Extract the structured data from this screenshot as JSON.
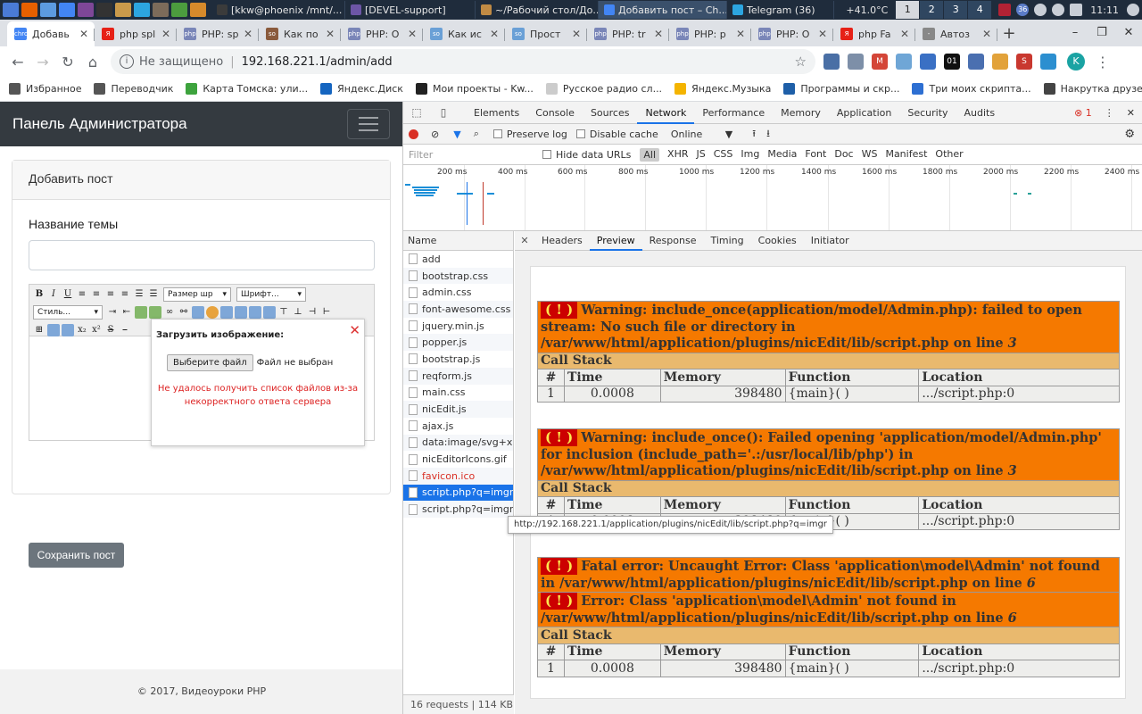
{
  "taskbar": {
    "tasks": [
      {
        "label": "[kkw@phoenix /mnt/...",
        "color": "#3b3b3b"
      },
      {
        "label": "[DEVEL-support]",
        "color": "#6d56a6"
      },
      {
        "label": "~/Рабочий стол/До...",
        "color": "#c08a44"
      },
      {
        "label": "Добавить пост – Ch...",
        "color": "#4285f4",
        "active": true
      },
      {
        "label": "Telegram (36)",
        "color": "#2ca5e0"
      }
    ],
    "temperature": "+41.0°C",
    "workspaces": [
      "1",
      "2",
      "3",
      "4"
    ],
    "clock": "11:11",
    "tray_badge": "36"
  },
  "browser": {
    "tabs": [
      {
        "title": "Добавь",
        "fav": "chrome",
        "color": "#4285f4",
        "active": true
      },
      {
        "title": "php spl",
        "fav": "Я",
        "color": "#e62117"
      },
      {
        "title": "PHP: sp",
        "fav": "php",
        "color": "#7a86b8"
      },
      {
        "title": "Как по",
        "fav": "so",
        "color": "#8a5a3c"
      },
      {
        "title": "PHP: O",
        "fav": "php",
        "color": "#7a86b8"
      },
      {
        "title": "Как ис",
        "fav": "so",
        "color": "#6aa0d6"
      },
      {
        "title": "Прост",
        "fav": "so",
        "color": "#6aa0d6"
      },
      {
        "title": "PHP: tr",
        "fav": "php",
        "color": "#7a86b8"
      },
      {
        "title": "PHP: p",
        "fav": "php",
        "color": "#7a86b8"
      },
      {
        "title": "PHP: O",
        "fav": "php",
        "color": "#7a86b8"
      },
      {
        "title": "php Fa",
        "fav": "Я",
        "color": "#e62117"
      },
      {
        "title": "Автоз",
        "fav": "-",
        "color": "#888888"
      }
    ],
    "omnibox": {
      "security": "Не защищено",
      "url": "192.168.221.1/admin/add"
    },
    "profile_initial": "K",
    "extensions": [
      {
        "color": "#4a6fa5",
        "label": ""
      },
      {
        "color": "#7d8fa8",
        "label": ""
      },
      {
        "color": "#d44638",
        "label": "M"
      },
      {
        "color": "#6fa6d6",
        "label": ""
      },
      {
        "color": "#3a70c4",
        "label": ""
      },
      {
        "color": "#111111",
        "label": "01"
      },
      {
        "color": "#4a6fb0",
        "label": ""
      },
      {
        "color": "#e2a23a",
        "label": ""
      },
      {
        "color": "#c9382f",
        "label": "S"
      },
      {
        "color": "#2c8fd0",
        "label": ""
      }
    ],
    "bookmarks": [
      {
        "label": "Избранное",
        "color": "#555555"
      },
      {
        "label": "Переводчик",
        "color": "#555555"
      },
      {
        "label": "Карта Томска: ули...",
        "color": "#3da33d"
      },
      {
        "label": "Яндекс.Диск",
        "color": "#1565c0"
      },
      {
        "label": "Мои проекты - Kw...",
        "color": "#222222"
      },
      {
        "label": "Русское радио сл...",
        "color": "#cccccc"
      },
      {
        "label": "Яндекс.Музыка",
        "color": "#f4b400"
      },
      {
        "label": "Программы и скр...",
        "color": "#1e5fa8"
      },
      {
        "label": "Три моих скрипта...",
        "color": "#2d6fd2"
      },
      {
        "label": "Накрутка друзей...",
        "color": "#444444"
      }
    ]
  },
  "page": {
    "brand": "Панель Администратора",
    "card_title": "Добавить пост",
    "topic_label": "Название темы",
    "editor": {
      "size_select": "Размер шр",
      "font_select": "Шрифт...",
      "style_select": "Стиль..."
    },
    "upload_popup": {
      "title": "Загрузить изображение:",
      "file_button": "Выберите файл",
      "file_status": "Файл не выбран",
      "error": "Не удалось получить список файлов из-за некорректного ответа сервера"
    },
    "save_button": "Сохранить пост",
    "footer": "© 2017, Видеоуроки PHP"
  },
  "devtools": {
    "panels": [
      "Elements",
      "Console",
      "Sources",
      "Network",
      "Performance",
      "Memory",
      "Application",
      "Security",
      "Audits"
    ],
    "active_panel": "Network",
    "error_count": "1",
    "controls": {
      "preserve_log": "Preserve log",
      "disable_cache": "Disable cache",
      "throttle": "Online"
    },
    "filter": {
      "placeholder": "Filter",
      "hide_data_urls": "Hide data URLs",
      "types": [
        "All",
        "XHR",
        "JS",
        "CSS",
        "Img",
        "Media",
        "Font",
        "Doc",
        "WS",
        "Manifest",
        "Other"
      ]
    },
    "timeline_ticks": [
      "200 ms",
      "400 ms",
      "600 ms",
      "800 ms",
      "1000 ms",
      "1200 ms",
      "1400 ms",
      "1600 ms",
      "1800 ms",
      "2000 ms",
      "2200 ms",
      "2400 ms"
    ],
    "name_header": "Name",
    "requests": [
      {
        "name": "add"
      },
      {
        "name": "bootstrap.css"
      },
      {
        "name": "admin.css"
      },
      {
        "name": "font-awesome.css"
      },
      {
        "name": "jquery.min.js"
      },
      {
        "name": "popper.js"
      },
      {
        "name": "bootstrap.js"
      },
      {
        "name": "reqform.js"
      },
      {
        "name": "main.css"
      },
      {
        "name": "nicEdit.js"
      },
      {
        "name": "ajax.js"
      },
      {
        "name": "data:image/svg+x..."
      },
      {
        "name": "nicEditorIcons.gif"
      },
      {
        "name": "favicon.ico",
        "error": true
      },
      {
        "name": "script.php?q=imgr",
        "selected": true
      },
      {
        "name": "script.php?q=imgr"
      }
    ],
    "status": "16 requests  |  114 KB t",
    "detail_tabs": [
      "Headers",
      "Preview",
      "Response",
      "Timing",
      "Cookies",
      "Initiator"
    ],
    "active_detail": "Preview",
    "tooltip": "http://192.168.221.1/application/plugins/nicEdit/lib/script.php?q=imgr",
    "preview": {
      "bang": "( ! )",
      "headers": [
        "#",
        "Time",
        "Memory",
        "Function",
        "Location"
      ],
      "call_stack": "Call Stack",
      "errors": [
        {
          "messages": [
            {
              "type": "Warning",
              "text": "include_once(application/model/Admin.php): failed to open stream: No such file or directory in /var/www/html/application/plugins/nicEdit/lib/script.php on line",
              "line": "3"
            }
          ],
          "row": {
            "n": "1",
            "time": "0.0008",
            "memory": "398480",
            "function": "{main}( )",
            "location": ".../script.php:0"
          }
        },
        {
          "messages": [
            {
              "type": "Warning",
              "text": "include_once(): Failed opening 'application/model/Admin.php' for inclusion (include_path='.:/usr/local/lib/php') in /var/www/html/application/plugins/nicEdit/lib/script.php on line",
              "line": "3"
            }
          ],
          "row": {
            "n": "1",
            "time": "0.0008",
            "memory": "398480",
            "function": "{main}( )",
            "location": ".../script.php:0"
          }
        },
        {
          "messages": [
            {
              "type": "Fatal error",
              "text": "Uncaught Error: Class 'application\\model\\Admin' not found in /var/www/html/application/plugins/nicEdit/lib/script.php on line",
              "line": "6"
            },
            {
              "type": "Error",
              "text": "Class 'application\\model\\Admin' not found in /var/www/html/application/plugins/nicEdit/lib/script.php on line",
              "line": "6"
            }
          ],
          "row": {
            "n": "1",
            "time": "0.0008",
            "memory": "398480",
            "function": "{main}( )",
            "location": ".../script.php:0"
          }
        }
      ]
    }
  }
}
